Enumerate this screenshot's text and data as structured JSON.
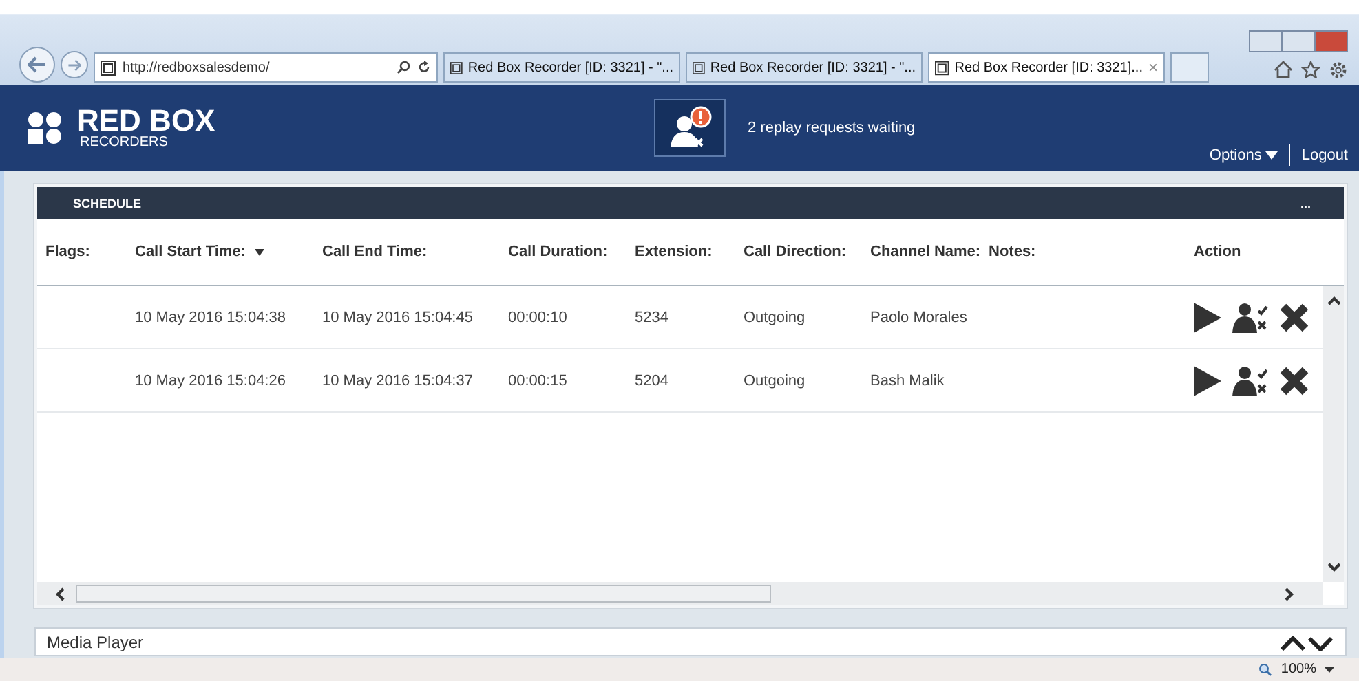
{
  "browser": {
    "address": "http://redboxsalesdemo/",
    "tabs": [
      {
        "title": "Red Box Recorder [ID: 3321] - \"...",
        "selected": false
      },
      {
        "title": "Red Box Recorder [ID: 3321] - \"...",
        "selected": false
      },
      {
        "title": "Red Box Recorder [ID: 3321]...",
        "selected": true
      }
    ],
    "tab_close": "×",
    "zoom": "100%"
  },
  "header": {
    "brand": "RED BOX",
    "brand_sub": "RECORDERS",
    "notification": "2 replay requests waiting",
    "menu": "Options",
    "logout": "Logout"
  },
  "schedule": {
    "title": "SCHEDULE",
    "more": "...",
    "columns": [
      {
        "label": "Flags:",
        "sorted": false
      },
      {
        "label": "Call Start Time:",
        "sorted": true
      },
      {
        "label": "Call End Time:",
        "sorted": false
      },
      {
        "label": "Call Duration:",
        "sorted": false
      },
      {
        "label": "Extension:",
        "sorted": false
      },
      {
        "label": "Call Direction:",
        "sorted": false
      },
      {
        "label": "Channel Name:",
        "sorted": false
      },
      {
        "label": "Notes:",
        "sorted": false
      },
      {
        "label": "Action",
        "sorted": false
      }
    ],
    "rows": [
      {
        "cells": [
          "",
          "10 May 2016 15:04:38",
          "10 May 2016 15:04:45",
          "00:00:10",
          "5234",
          "Outgoing",
          "Paolo Morales",
          ""
        ]
      },
      {
        "cells": [
          "",
          "10 May 2016 15:04:26",
          "10 May 2016 15:04:37",
          "00:00:15",
          "5204",
          "Outgoing",
          "Bash Malik",
          ""
        ]
      }
    ]
  },
  "media_player": {
    "title": "Media Player"
  }
}
